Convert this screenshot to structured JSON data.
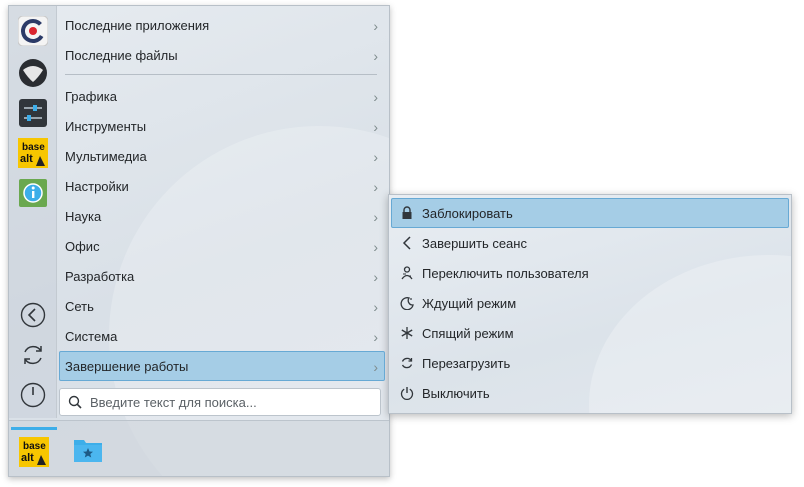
{
  "favorites": [
    {
      "name": "app-c-circle",
      "icon": "c-circle-logo-icon"
    },
    {
      "name": "app-dark-round",
      "icon": "dark-globe-icon"
    },
    {
      "name": "app-sliders",
      "icon": "sliders-settings-icon"
    },
    {
      "name": "app-basealt",
      "icon": "basealt-logo-icon",
      "line1": "base",
      "line2": "alt"
    },
    {
      "name": "app-info",
      "icon": "info-icon"
    }
  ],
  "power_buttons": [
    {
      "name": "back-button",
      "icon": "back-arrow-icon"
    },
    {
      "name": "restart-button",
      "icon": "restart-icon"
    },
    {
      "name": "shutdown-button",
      "icon": "power-icon"
    }
  ],
  "categories_top": [
    {
      "label": "Последние приложения"
    },
    {
      "label": "Последние файлы"
    }
  ],
  "categories": [
    {
      "label": "Графика"
    },
    {
      "label": "Инструменты"
    },
    {
      "label": "Мультимедиа"
    },
    {
      "label": "Настройки"
    },
    {
      "label": "Наука"
    },
    {
      "label": "Офис"
    },
    {
      "label": "Разработка"
    },
    {
      "label": "Сеть"
    },
    {
      "label": "Система"
    },
    {
      "label": "Завершение работы"
    }
  ],
  "active_category": "Завершение работы",
  "search": {
    "placeholder": "Введите текст для поиска...",
    "value": ""
  },
  "bottom_apps": [
    {
      "name": "basealt-app",
      "line1": "base",
      "line2": "alt"
    },
    {
      "name": "favorite-folder",
      "icon": "folder-star-icon"
    }
  ],
  "submenu": [
    {
      "label": "Заблокировать",
      "icon": "lock-icon"
    },
    {
      "label": "Завершить сеанс",
      "icon": "logout-icon"
    },
    {
      "label": "Переключить пользователя",
      "icon": "switch-user-icon"
    },
    {
      "label": "Ждущий режим",
      "icon": "sleep-icon"
    },
    {
      "label": "Спящий режим",
      "icon": "hibernate-icon"
    },
    {
      "label": "Перезагрузить",
      "icon": "reboot-icon"
    },
    {
      "label": "Выключить",
      "icon": "power-off-icon"
    }
  ],
  "active_submenu": "Заблокировать",
  "colors": {
    "accent": "#3daee9",
    "highlight": "#a5cde6",
    "highlight_border": "#67a9d4"
  }
}
